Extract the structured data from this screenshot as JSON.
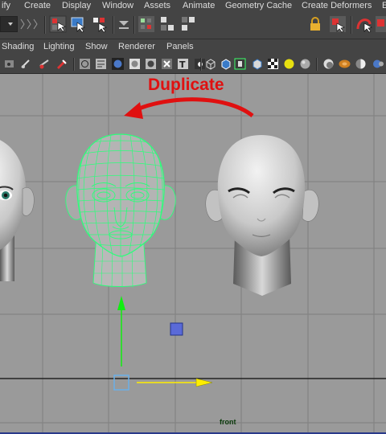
{
  "menu": {
    "items": [
      "ify",
      "Create",
      "Display",
      "Window",
      "Assets",
      "Animate",
      "Geometry Cache",
      "Create Deformers",
      "E"
    ]
  },
  "panel_menu": {
    "items": [
      "Shading",
      "Lighting",
      "Show",
      "Renderer",
      "Panels"
    ]
  },
  "annotation": {
    "text": "Duplicate",
    "color": "#e01010"
  },
  "viewport": {
    "camera_label": "front",
    "background": "#9a9a9a",
    "selection_color": "#2bff7a"
  }
}
